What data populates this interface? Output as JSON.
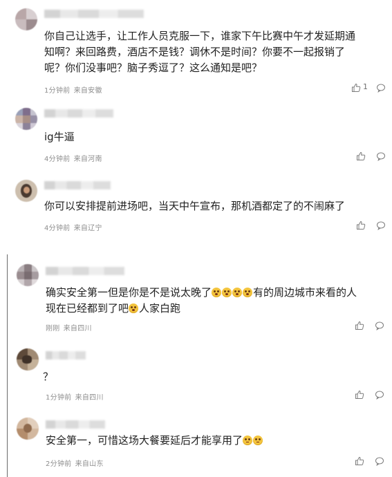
{
  "comments_top": [
    {
      "text": "你自己让选手，让工作人员克服一下，谁家下午比赛中午才发延期通\n知啊？来回路费，酒店不是钱？调休不是时间？你要不一起报销了\n呢？你们没事吧？脑子秀逗了？这么通知是吧？",
      "time": "1分钟前",
      "location": "来自安徽",
      "likes": "1"
    },
    {
      "text": "ig牛逼",
      "time": "4分钟前",
      "location": "来自河南",
      "likes": ""
    },
    {
      "text": "你可以安排提前进场吧，当天中午宣布，那机酒都定了的不闹麻了",
      "time": "4分钟前",
      "location": "来自辽宁",
      "likes": ""
    }
  ],
  "comments_bottom": [
    {
      "text_before_emoji": "确实安全第一但是你是不是说太晚了",
      "emoji_group_1_count": 4,
      "text_middle": "有的周边城市来看的人\n现在已经都到了吧",
      "emoji_group_2_count": 1,
      "text_after": "人家白跑",
      "time": "刚刚",
      "location": "来自四川"
    },
    {
      "text": "？",
      "time": "1分钟前",
      "location": "来自四川"
    },
    {
      "text": "安全第一，可惜这场大餐要延后才能享用了",
      "emoji_count": 2,
      "time": "2分钟前",
      "location": "来自山东"
    }
  ],
  "icons": {
    "like": "thumbs-up-icon",
    "reply": "speech-bubble-icon"
  }
}
